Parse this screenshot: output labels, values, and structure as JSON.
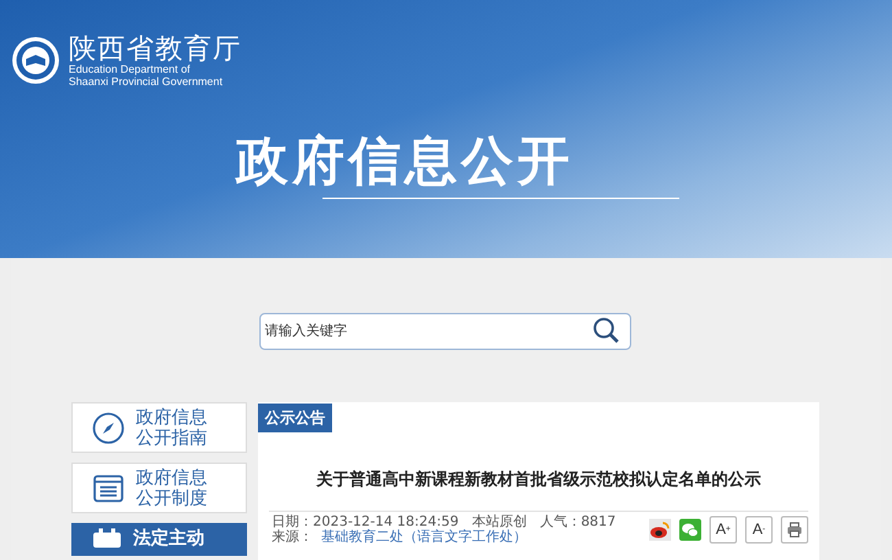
{
  "header": {
    "org_name": "陕西省教育厅",
    "org_name_en": [
      "Education Department of",
      "Shaanxi Provincial Government"
    ],
    "banner_title": "政府信息公开"
  },
  "search": {
    "placeholder": "请输入关键字"
  },
  "sidebar": {
    "items": [
      {
        "label": [
          "政府信息",
          "公开指南"
        ],
        "kind": "compass",
        "selected": false
      },
      {
        "label": [
          "政府信息",
          "公开制度"
        ],
        "kind": "list",
        "selected": false
      },
      {
        "label": [
          "法定主动"
        ],
        "kind": "calendar",
        "selected": true
      }
    ]
  },
  "article": {
    "section": "公示公告",
    "title": "关于普通高中新课程新教材首批省级示范校拟认定名单的公示",
    "date_label": "日期：",
    "date": "2023-12-14 18:24:59",
    "origin": "本站原创",
    "views_label": "人气：",
    "views": "8817",
    "source_label": "来源：",
    "source_link": "基础教育二处（语言文字工作处）",
    "tools": [
      {
        "kind": "weibo"
      },
      {
        "kind": "wechat"
      },
      {
        "kind": "font-up",
        "label": "A",
        "mark": "+"
      },
      {
        "kind": "font-down",
        "label": "A",
        "mark": "-"
      },
      {
        "kind": "print"
      }
    ]
  }
}
